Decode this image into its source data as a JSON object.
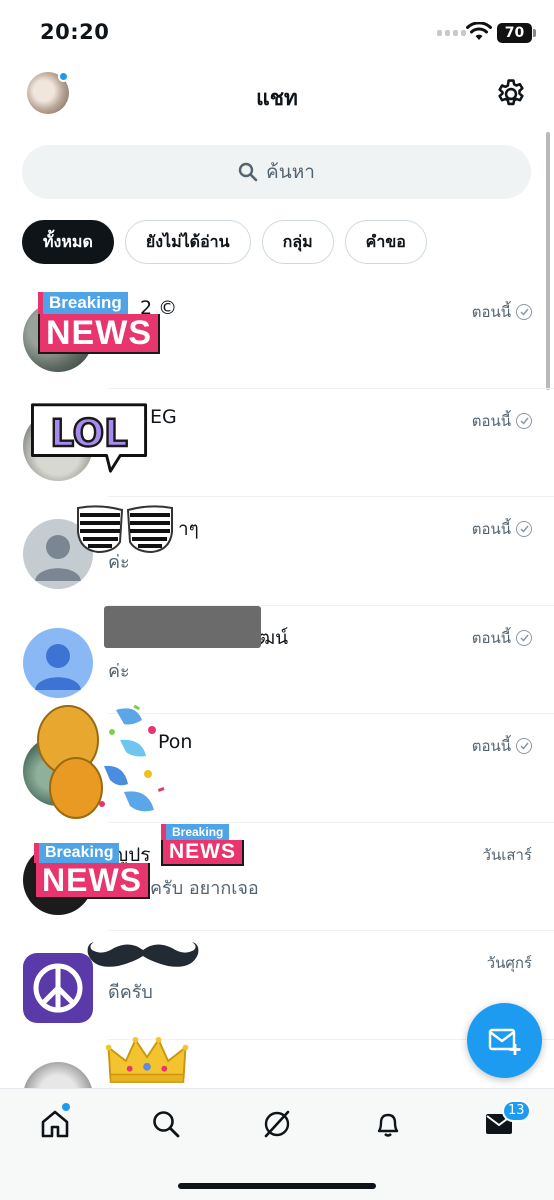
{
  "status_bar": {
    "time": "20:20",
    "battery": "70"
  },
  "header": {
    "title": "แชท"
  },
  "search": {
    "placeholder": "ค้นหา"
  },
  "filters": [
    "ทั้งหมด",
    "ยังไม่ได้อ่าน",
    "กลุ่ม",
    "คำขอ"
  ],
  "chats": [
    {
      "name": "2 ©",
      "preview": "",
      "time": "ตอนนี้",
      "read": true
    },
    {
      "name": "EG",
      "preview": "",
      "time": "ตอนนี้",
      "read": true
    },
    {
      "name": "าๆ",
      "preview": "ค่ะ",
      "time": "ตอนนี้",
      "read": true
    },
    {
      "name": "ฒน์",
      "preview": "ค่ะ",
      "time": "ตอนนี้",
      "read": true
    },
    {
      "name": "Pon",
      "preview": "",
      "time": "ตอนนี้",
      "read": true
    },
    {
      "name": "ญูปร",
      "preview": "ครับ อยากเจอ",
      "time": "วันเสาร์",
      "read": false
    },
    {
      "name": "",
      "preview": "ดีครับ",
      "time": "วันศุกร์",
      "read": false
    },
    {
      "name": "",
      "preview": "",
      "time": "",
      "read": false
    }
  ],
  "stickers": {
    "breaking_label": "Breaking",
    "news_label": "NEWS",
    "lol_label": "LOL"
  },
  "tab_bar": {
    "messages_badge": "13"
  },
  "colors": {
    "accent": "#1d9bf0",
    "text": "#0f1419",
    "secondary": "#536471"
  }
}
